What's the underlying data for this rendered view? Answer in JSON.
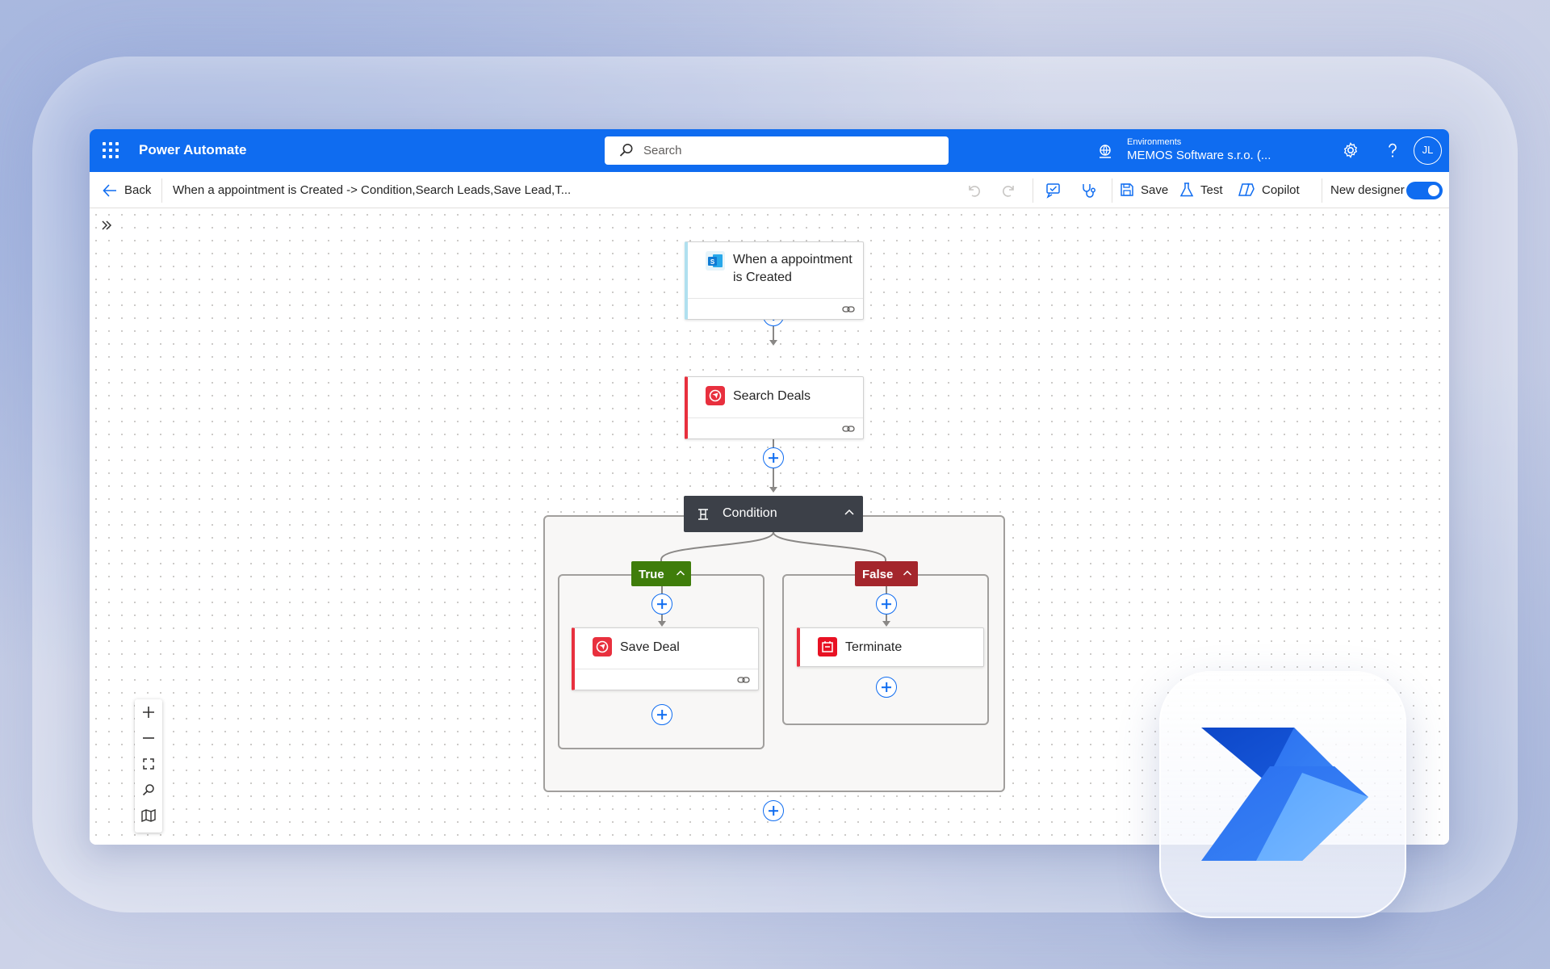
{
  "app": {
    "name": "Power Automate",
    "search_placeholder": "Search",
    "environment_label": "Environments",
    "environment_value": "MEMOS Software s.r.o. (...",
    "avatar_initials": "JL"
  },
  "command_bar": {
    "back_label": "Back",
    "flow_title": "When a appointment is Created -> Condition,Search Leads,Save Lead,T...",
    "save_label": "Save",
    "test_label": "Test",
    "copilot_label": "Copilot",
    "new_designer_label": "New designer",
    "new_designer_on": true
  },
  "flow": {
    "trigger": {
      "title_line1": "When a appointment",
      "title_line2": "is Created",
      "accent": "#b0e0ef"
    },
    "step2": {
      "title": "Search Deals",
      "accent": "#e8303e"
    },
    "condition": {
      "title": "Condition",
      "true_label": "True",
      "false_label": "False",
      "true_color": "#3f7d0b",
      "false_color": "#a4262c"
    },
    "true_branch": {
      "action": "Save Deal"
    },
    "false_branch": {
      "action": "Terminate"
    }
  },
  "colors": {
    "brand": "#0f6cf0",
    "condition_header": "#3c4048"
  }
}
